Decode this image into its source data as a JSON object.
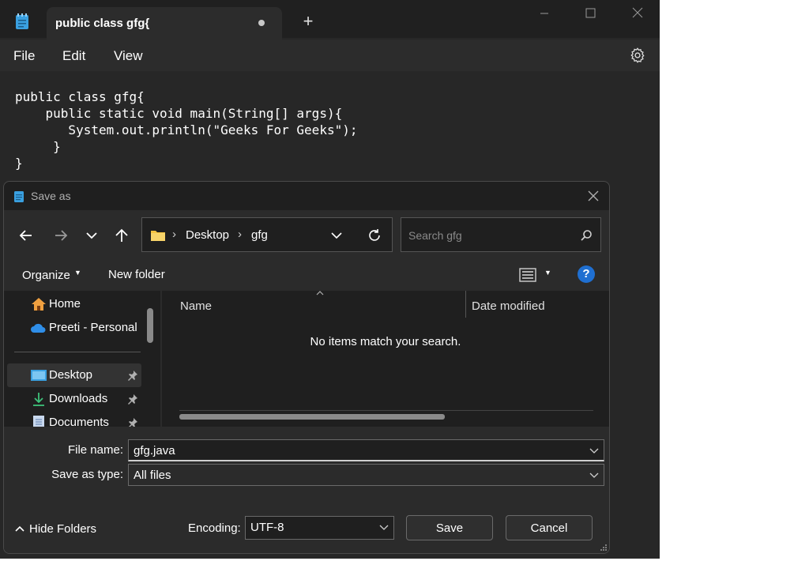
{
  "notepad": {
    "tab_title": "public class gfg{",
    "menu": [
      "File",
      "Edit",
      "View"
    ],
    "code_lines": [
      "public class gfg{",
      "    public static void main(String[] args){",
      "       System.out.println(\"Geeks For Geeks\");",
      "     }",
      "}"
    ]
  },
  "dialog": {
    "title": "Save as",
    "breadcrumb": [
      "Desktop",
      "gfg"
    ],
    "search_placeholder": "Search gfg",
    "toolbar": {
      "organize": "Organize",
      "new_folder": "New folder"
    },
    "sidebar": {
      "items": [
        {
          "label": "Home"
        },
        {
          "label": "Preeti - Personal"
        },
        {
          "label": "Desktop"
        },
        {
          "label": "Downloads"
        },
        {
          "label": "Documents"
        }
      ]
    },
    "columns": {
      "name": "Name",
      "date_modified": "Date modified"
    },
    "empty_message": "No items match your search.",
    "file_name_label": "File name:",
    "file_name_value": "gfg.java",
    "save_type_label": "Save as type:",
    "save_type_value": "All files",
    "hide_folders": "Hide Folders",
    "encoding_label": "Encoding:",
    "encoding_value": "UTF-8",
    "save_button": "Save",
    "cancel_button": "Cancel"
  },
  "colors": {
    "accent": "#1f6fd1",
    "folder": "#f5c342",
    "onedrive": "#2f8ee8"
  }
}
